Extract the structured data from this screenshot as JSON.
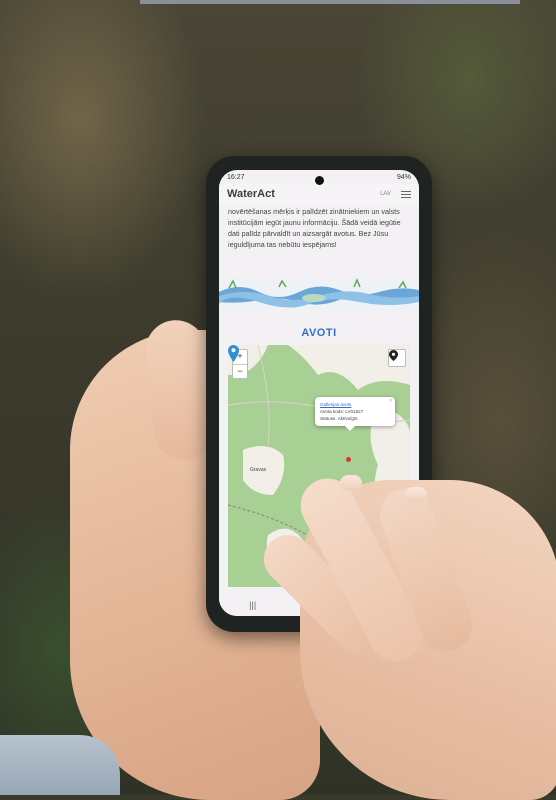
{
  "app": {
    "brand": "WaterAct",
    "lang": "LAV",
    "menu_icon": "hamburger-menu-icon"
  },
  "status_bar": {
    "time": "16:27",
    "battery": "94%"
  },
  "intro_text": "novērtēšanas mērķis ir palīdzēt zinātniekiem un valsts institūcijām iegūt jaunu informāciju. Šādā veidā iegūtie dati palīdz pārvaldīt un aizsargāt avotus. Bez Jūsu ieguldījuma tas nebūtu iespējams!",
  "section_title": "AVOTI",
  "map": {
    "zoom_in": "+",
    "zoom_out": "−",
    "locate_icon": "map-pin-icon",
    "place_label": "Gravas",
    "popup": {
      "link": "Gallerijas avots",
      "code": "Avota kods: LV01627",
      "status": "Statuss: Aktīvs/gts"
    },
    "colors": {
      "forest": "#a8cf94",
      "clearing": "#f2efe9",
      "pin": "#2f8fd6"
    }
  },
  "nav": {
    "recent": "|||",
    "back": "‹"
  },
  "colors": {
    "accent": "#2f6ec5"
  }
}
